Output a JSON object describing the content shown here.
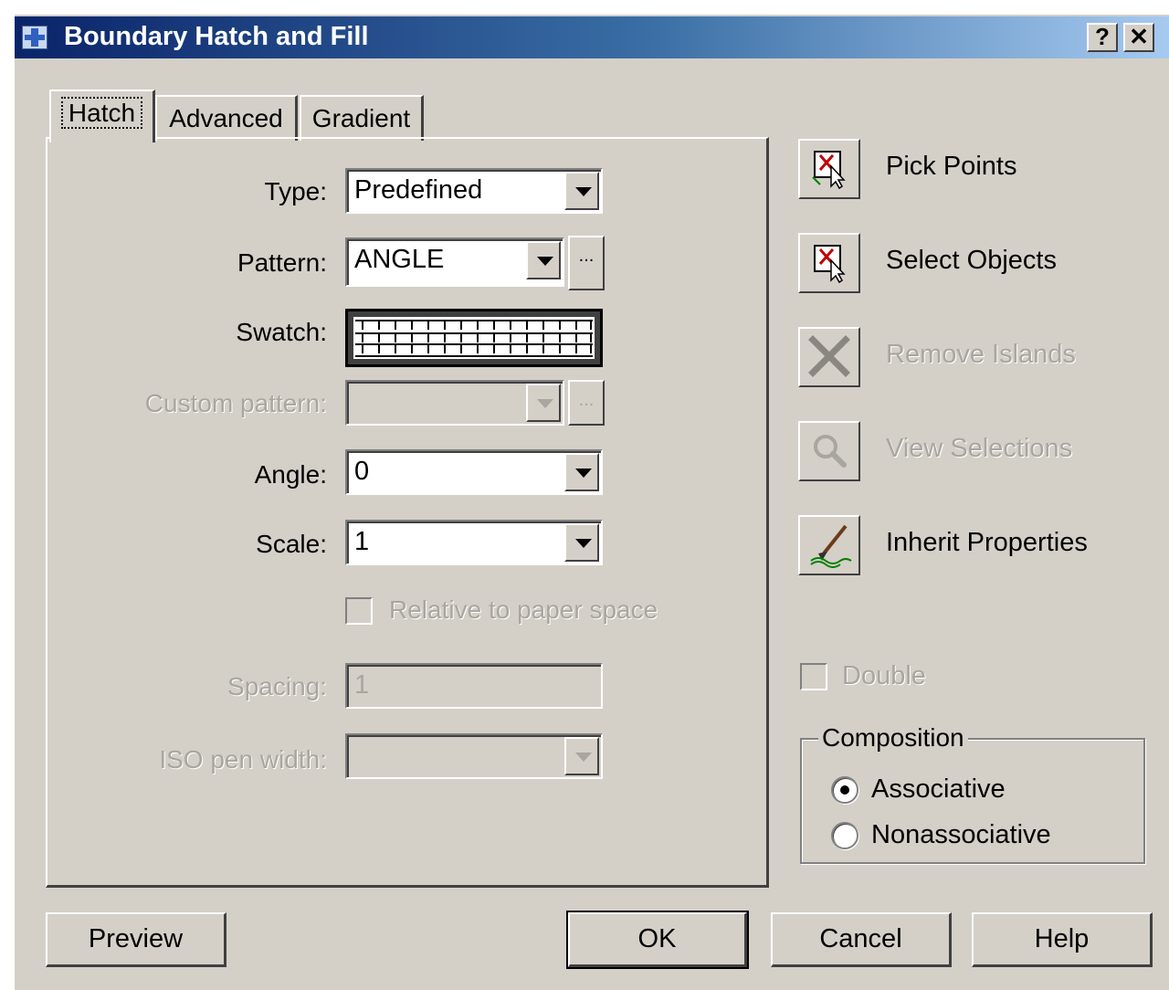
{
  "window": {
    "title": "Boundary Hatch and Fill",
    "help_label": "?",
    "close_label": "✕"
  },
  "tabs": [
    {
      "label": "Hatch"
    },
    {
      "label": "Advanced"
    },
    {
      "label": "Gradient"
    }
  ],
  "hatch": {
    "type_label": "Type:",
    "type_value": "Predefined",
    "pattern_label": "Pattern:",
    "pattern_value": "ANGLE",
    "pattern_browse_label": "...",
    "swatch_label": "Swatch:",
    "custom_pattern_label": "Custom pattern:",
    "custom_pattern_value": "",
    "custom_browse_label": "...",
    "angle_label": "Angle:",
    "angle_value": "0",
    "scale_label": "Scale:",
    "scale_value": "1",
    "relative_label": "Relative to paper space",
    "relative_checked": false,
    "spacing_label": "Spacing:",
    "spacing_value": "1",
    "iso_label": "ISO pen width:",
    "iso_value": ""
  },
  "actions": {
    "pick_points": "Pick Points",
    "select_objects": "Select Objects",
    "remove_islands": "Remove Islands",
    "view_selections": "View Selections",
    "inherit_properties": "Inherit Properties"
  },
  "double": {
    "label": "Double",
    "checked": false
  },
  "composition": {
    "title": "Composition",
    "associative": "Associative",
    "nonassociative": "Nonassociative",
    "selected": "Associative"
  },
  "buttons": {
    "preview": "Preview",
    "ok": "OK",
    "cancel": "Cancel",
    "help": "Help"
  },
  "colors": {
    "face": "#d4d0c8",
    "title_start": "#0a246a",
    "title_end": "#a6caf0",
    "disabled_text": "#a9a69f"
  }
}
